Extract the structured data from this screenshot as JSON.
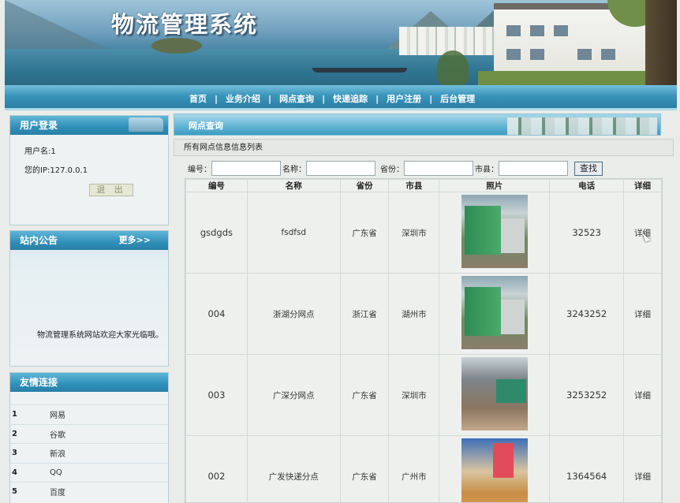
{
  "header": {
    "site_title": "物流管理系统"
  },
  "nav": {
    "items": [
      "首页",
      "业务介绍",
      "网点查询",
      "快递追踪",
      "用户注册",
      "后台管理"
    ]
  },
  "login": {
    "title": "用户登录",
    "username_line": "用户名:1",
    "ip_line": "您的IP:127.0.0.1",
    "logout_label": "退 出"
  },
  "notice": {
    "title": "站内公告",
    "more_label": "更多>>",
    "text": "物流管理系统网站欢迎大家光临哦。"
  },
  "links": {
    "title": "友情连接",
    "items": [
      {
        "num": "1",
        "name": "网易"
      },
      {
        "num": "2",
        "name": "谷歌"
      },
      {
        "num": "3",
        "name": "新浪"
      },
      {
        "num": "4",
        "name": "QQ"
      },
      {
        "num": "5",
        "name": "百度"
      }
    ]
  },
  "main": {
    "section_title": "网点查询",
    "list_title": "所有网点信息信息列表",
    "search": {
      "code_label": "编号：",
      "name_label": "名称：",
      "province_label": "省份：",
      "city_label": "市县：",
      "button_label": "查找"
    },
    "table": {
      "headers": [
        "编号",
        "名称",
        "省份",
        "市县",
        "照片",
        "电话",
        "详细"
      ],
      "rows": [
        {
          "code": "gsdgds",
          "name": "fsdfsd",
          "province": "广东省",
          "city": "深圳市",
          "photo": "truck",
          "phone": "32523",
          "detail": "详细"
        },
        {
          "code": "004",
          "name": "浙湖分网点",
          "province": "浙江省",
          "city": "湖州市",
          "photo": "truck",
          "phone": "3243252",
          "detail": "详细"
        },
        {
          "code": "003",
          "name": "广深分网点",
          "province": "广东省",
          "city": "深圳市",
          "photo": "depot",
          "phone": "3253252",
          "detail": "详细"
        },
        {
          "code": "002",
          "name": "广发快递分点",
          "province": "广东省",
          "city": "广州市",
          "photo": "market",
          "phone": "1364564",
          "detail": "详细"
        }
      ]
    }
  }
}
